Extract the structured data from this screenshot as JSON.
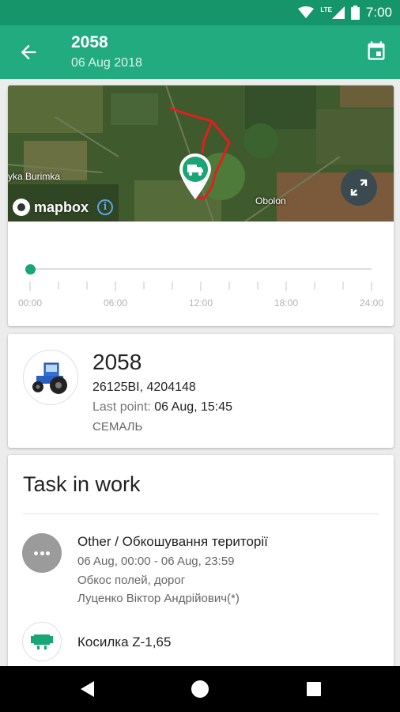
{
  "status_bar": {
    "time": "7:00",
    "network": "LTE"
  },
  "app_bar": {
    "title": "2058",
    "subtitle": "06 Aug 2018",
    "back_icon": "arrow-back-icon",
    "calendar_icon": "calendar-icon"
  },
  "map": {
    "place_labels": [
      "yka Burimka",
      "Obolon"
    ],
    "attribution": "mapbox",
    "marker_icon": "truck-icon",
    "expand_icon": "expand-icon",
    "info_icon": "info-icon",
    "route_color": "#e02020"
  },
  "timeline": {
    "labels": [
      "00:00",
      "06:00",
      "12:00",
      "18:00",
      "24:00"
    ],
    "position": 0,
    "accent": "#1aa577"
  },
  "vehicle": {
    "name": "2058",
    "ids": "26125BI, 4204148",
    "last_point_label": "Last point:",
    "last_point_value": "06 Aug, 15:45",
    "company": "СЕМАЛЬ",
    "avatar_icon": "tractor-icon"
  },
  "task": {
    "heading": "Task in work",
    "name": "Other / Обкошування території",
    "time": "06 Aug, 00:00 - 06 Aug, 23:59",
    "description": "Обкос полей, дорог",
    "person": "Луценко Віктор Андрійович(*)",
    "implement": "Косилка Z-1,65",
    "more_icon": "more-horiz-icon",
    "implement_icon": "implement-icon"
  },
  "colors": {
    "primary": "#21ab7f",
    "status_bar": "#17956a"
  }
}
